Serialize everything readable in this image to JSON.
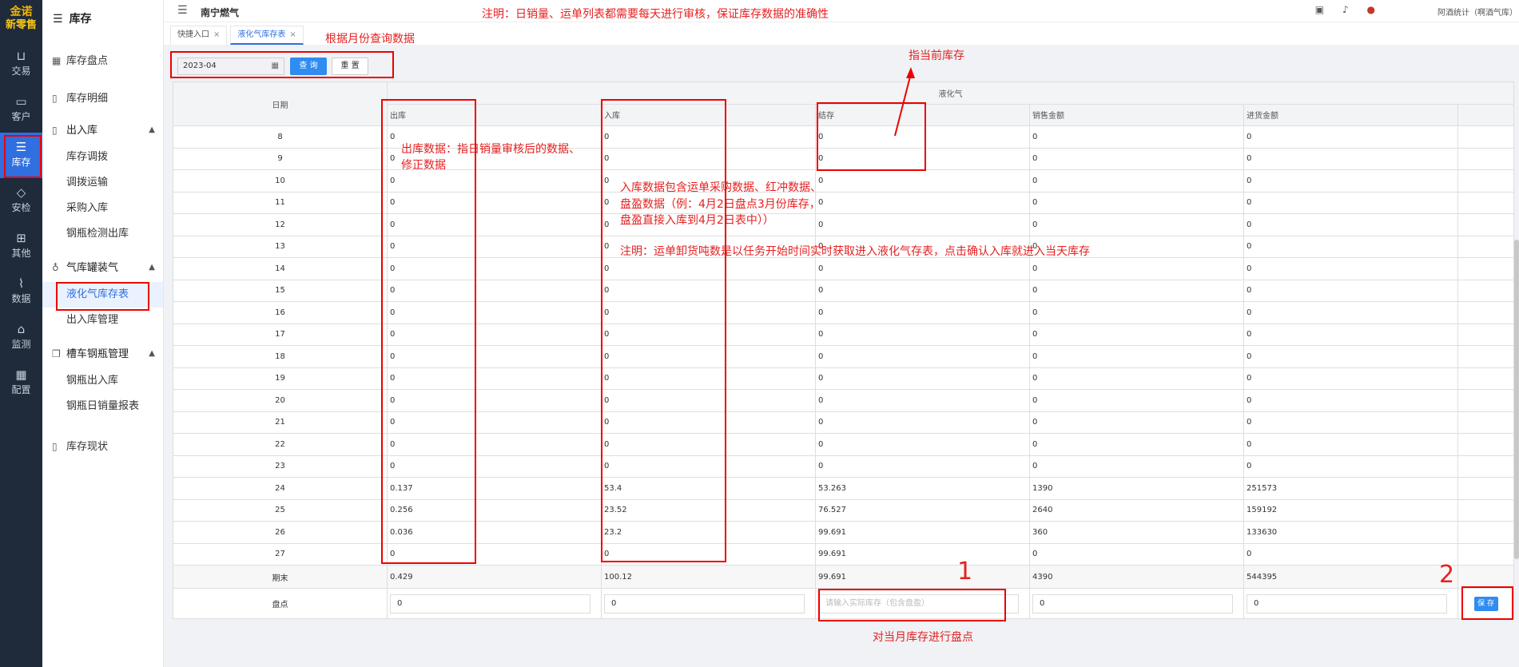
{
  "rail": {
    "logo_line1": "金诺",
    "logo_line2": "新零售",
    "items": [
      {
        "label": "交易",
        "icon": "bag-icon"
      },
      {
        "label": "客户",
        "icon": "id-card-icon"
      },
      {
        "label": "库存",
        "icon": "list-icon"
      },
      {
        "label": "安检",
        "icon": "shield-icon"
      },
      {
        "label": "其他",
        "icon": "blocks-icon"
      },
      {
        "label": "数据",
        "icon": "chart-icon"
      },
      {
        "label": "监测",
        "icon": "alarm-icon"
      },
      {
        "label": "配置",
        "icon": "grid-icon"
      }
    ]
  },
  "sidebar": {
    "title": "库存",
    "items": [
      {
        "label": "库存盘点"
      },
      {
        "label": "库存明细"
      }
    ],
    "groups": [
      {
        "label": "出入库",
        "subs": [
          "库存调拨",
          "调拨运输",
          "采购入库",
          "钢瓶检测出库"
        ]
      },
      {
        "label": "气库罐装气",
        "subs": [
          "液化气库存表",
          "出入库管理"
        ]
      },
      {
        "label": "槽车钢瓶管理",
        "subs": [
          "钢瓶出入库",
          "钢瓶日销量报表"
        ]
      }
    ],
    "bottom": "库存现状"
  },
  "topbar": {
    "title": "南宁燃气",
    "user": "阿酒统计（啊酒气库）"
  },
  "tabs": [
    {
      "label": "快捷入口"
    },
    {
      "label": "液化气库存表"
    }
  ],
  "filter": {
    "month": "2023-04",
    "query_label": "查 询",
    "reset_label": "重 置"
  },
  "table": {
    "col_date": "日期",
    "group_header": "液化气",
    "cols": [
      "出库",
      "入库",
      "结存",
      "销售金额",
      "进货金额"
    ],
    "rows": [
      {
        "day": "8",
        "v": [
          "0",
          "0",
          "0",
          "0",
          "0"
        ]
      },
      {
        "day": "9",
        "v": [
          "0",
          "0",
          "0",
          "0",
          "0"
        ]
      },
      {
        "day": "10",
        "v": [
          "0",
          "0",
          "0",
          "0",
          "0"
        ]
      },
      {
        "day": "11",
        "v": [
          "0",
          "0",
          "0",
          "0",
          "0"
        ]
      },
      {
        "day": "12",
        "v": [
          "0",
          "0",
          "0",
          "0",
          "0"
        ]
      },
      {
        "day": "13",
        "v": [
          "0",
          "0",
          "0",
          "0",
          "0"
        ]
      },
      {
        "day": "14",
        "v": [
          "0",
          "0",
          "0",
          "0",
          "0"
        ]
      },
      {
        "day": "15",
        "v": [
          "0",
          "0",
          "0",
          "0",
          "0"
        ]
      },
      {
        "day": "16",
        "v": [
          "0",
          "0",
          "0",
          "0",
          "0"
        ]
      },
      {
        "day": "17",
        "v": [
          "0",
          "0",
          "0",
          "0",
          "0"
        ]
      },
      {
        "day": "18",
        "v": [
          "0",
          "0",
          "0",
          "0",
          "0"
        ]
      },
      {
        "day": "19",
        "v": [
          "0",
          "0",
          "0",
          "0",
          "0"
        ]
      },
      {
        "day": "20",
        "v": [
          "0",
          "0",
          "0",
          "0",
          "0"
        ]
      },
      {
        "day": "21",
        "v": [
          "0",
          "0",
          "0",
          "0",
          "0"
        ]
      },
      {
        "day": "22",
        "v": [
          "0",
          "0",
          "0",
          "0",
          "0"
        ]
      },
      {
        "day": "23",
        "v": [
          "0",
          "0",
          "0",
          "0",
          "0"
        ]
      },
      {
        "day": "24",
        "v": [
          "0.137",
          "53.4",
          "53.263",
          "1390",
          "251573"
        ]
      },
      {
        "day": "25",
        "v": [
          "0.256",
          "23.52",
          "76.527",
          "2640",
          "159192"
        ]
      },
      {
        "day": "26",
        "v": [
          "0.036",
          "23.2",
          "99.691",
          "360",
          "133630"
        ]
      },
      {
        "day": "27",
        "v": [
          "0",
          "0",
          "99.691",
          "0",
          "0"
        ]
      }
    ],
    "summary": {
      "label": "期末",
      "v": [
        "0.429",
        "100.12",
        "99.691",
        "4390",
        "544395"
      ]
    },
    "count": {
      "label": "盘点",
      "values": [
        "0",
        "0",
        "",
        "0",
        "0"
      ],
      "placeholder": "请输入实际库存（包含盘盈）",
      "save_label": "保 存"
    }
  },
  "annotations": {
    "top_note": "注明：日销量、运单列表都需要每天进行审核，保证库存数据的准确性",
    "month_note": "根据月份查询数据",
    "current_stock": "指当前库存",
    "out_note_1": "出库数据：指日销量审核后的数据、",
    "out_note_2": "修正数据",
    "in_note_1": "入库数据包含运单采购数据、红冲数据、",
    "in_note_2": "盘盈数据（例：4月2日盘点3月份库存，",
    "in_note_3": "盘盈直接入库到4月2日表中））",
    "transport_note": "注明：运单卸货吨数是以任务开始时间实时获取进入液化气存表，点击确认入库就进入当天库存",
    "num1": "1",
    "num2": "2",
    "count_note": "对当月库存进行盘点"
  },
  "colors": {
    "accent": "#2f8cf0",
    "annotation": "#e62020",
    "rail_bg": "#1f2a3a"
  }
}
